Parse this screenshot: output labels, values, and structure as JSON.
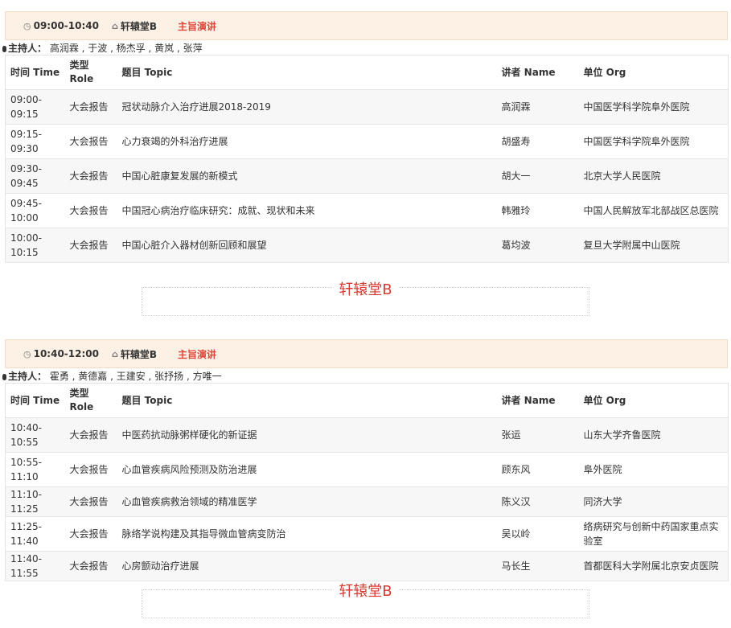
{
  "sessions": [
    {
      "time": "09:00-10:40",
      "room": "轩辕堂B",
      "type": "主旨演讲",
      "hosts_label": "主持人：",
      "hosts": "高润霖 , 于波 , 杨杰孚 , 黄岚 , 张萍",
      "columns": [
        "时间 Time",
        "类型 Role",
        "题目 Topic",
        "讲者 Name",
        "单位 Org"
      ],
      "rows": [
        {
          "time": "09:00-09:15",
          "role": "大会报告",
          "topic": "冠状动脉介入治疗进展2018-2019",
          "name": "高润霖",
          "org": "中国医学科学院阜外医院"
        },
        {
          "time": "09:15-09:30",
          "role": "大会报告",
          "topic": "心力衰竭的外科治疗进展",
          "name": "胡盛寿",
          "org": "中国医学科学院阜外医院"
        },
        {
          "time": "09:30-09:45",
          "role": "大会报告",
          "topic": "中国心脏康复发展的新模式",
          "name": "胡大一",
          "org": "北京大学人民医院"
        },
        {
          "time": "09:45-10:00",
          "role": "大会报告",
          "topic": "中国冠心病治疗临床研究：成就、现状和未来",
          "name": "韩雅玲",
          "org": "中国人民解放军北部战区总医院"
        },
        {
          "time": "10:00-10:15",
          "role": "大会报告",
          "topic": "中国心脏介入器材创新回顾和展望",
          "name": "葛均波",
          "org": "复旦大学附属中山医院"
        }
      ],
      "hall_title": "轩辕堂B"
    },
    {
      "time": "10:40-12:00",
      "room": "轩辕堂B",
      "type": "主旨演讲",
      "hosts_label": "主持人：",
      "hosts": "霍勇 , 黄德嘉 , 王建安 , 张抒扬 , 方唯一",
      "columns": [
        "时间 Time",
        "类型 Role",
        "题目 Topic",
        "讲者 Name",
        "单位 Org"
      ],
      "rows": [
        {
          "time": "10:40-10:55",
          "role": "大会报告",
          "topic": "中医药抗动脉粥样硬化的新证据",
          "name": "张运",
          "org": "山东大学齐鲁医院"
        },
        {
          "time": "10:55-11:10",
          "role": "大会报告",
          "topic": "心血管疾病风险预测及防治进展",
          "name": "顾东风",
          "org": "阜外医院"
        },
        {
          "time": "11:10-11:25",
          "role": "大会报告",
          "topic": "心血管疾病救治领域的精准医学",
          "name": "陈义汉",
          "org": "同济大学"
        },
        {
          "time": "11:25-11:40",
          "role": "大会报告",
          "topic": "脉络学说构建及其指导微血管病变防治",
          "name": "吴以岭",
          "org": "络病研究与创新中药国家重点实验室"
        },
        {
          "time": "11:40-11:55",
          "role": "大会报告",
          "topic": "心房颤动治疗进展",
          "name": "马长生",
          "org": "首都医科大学附属北京安贞医院"
        }
      ],
      "hall_title": "轩辕堂B"
    }
  ]
}
